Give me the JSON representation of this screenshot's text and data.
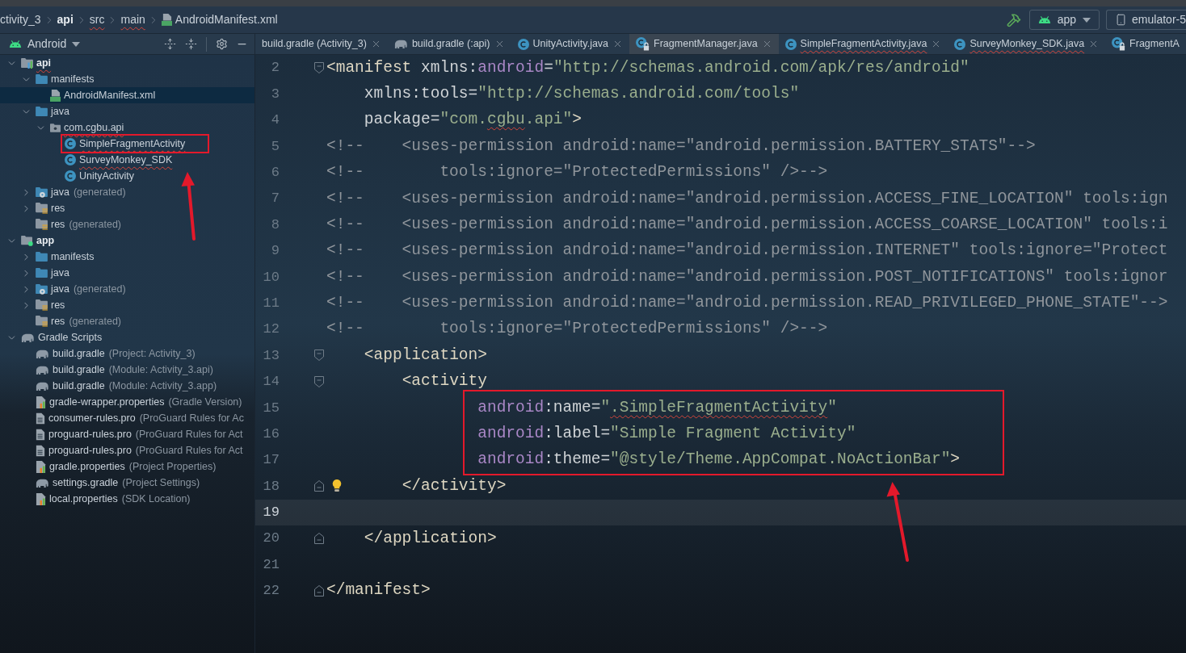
{
  "breadcrumbs": [
    {
      "label": "ctivity_3",
      "kind": "project",
      "typo": false
    },
    {
      "label": "api",
      "kind": "module",
      "typo": false
    },
    {
      "label": "src",
      "kind": "folder",
      "typo": true
    },
    {
      "label": "main",
      "kind": "folder",
      "typo": true
    },
    {
      "label": "AndroidManifest.xml",
      "kind": "manifest",
      "typo": false
    }
  ],
  "run_toolbar": {
    "configuration": "app",
    "device": "emulator-5"
  },
  "project_panel": {
    "view": "Android",
    "tree": [
      {
        "label": "api",
        "kind": "module",
        "expanded": true,
        "selected": false,
        "typo": true,
        "children": [
          {
            "label": "manifests",
            "kind": "folder",
            "expanded": true,
            "selected": false,
            "typo": false,
            "children": [
              {
                "label": "AndroidManifest.xml",
                "kind": "manifest",
                "selected": true,
                "typo": false
              }
            ]
          },
          {
            "label": "java",
            "kind": "folder",
            "expanded": true,
            "selected": false,
            "typo": false,
            "children": [
              {
                "label": "com.cgbu.api",
                "kind": "package",
                "expanded": true,
                "selected": false,
                "typo": true,
                "children": [
                  {
                    "label": "SimpleFragmentActivity",
                    "kind": "class",
                    "selected": false,
                    "typo": true,
                    "marked": true
                  },
                  {
                    "label": "SurveyMonkey_SDK",
                    "kind": "class",
                    "selected": false,
                    "typo": true
                  },
                  {
                    "label": "UnityActivity",
                    "kind": "class",
                    "selected": false,
                    "typo": false
                  }
                ]
              }
            ]
          },
          {
            "label": "java",
            "detail": "(generated)",
            "kind": "generated",
            "expanded": false,
            "selected": false,
            "typo": false
          },
          {
            "label": "res",
            "kind": "resources",
            "expanded": false,
            "selected": false,
            "typo": false
          },
          {
            "label": "res",
            "detail": "(generated)",
            "kind": "resources",
            "selected": false,
            "typo": false
          }
        ]
      },
      {
        "label": "app",
        "kind": "app",
        "expanded": true,
        "selected": false,
        "typo": false,
        "children": [
          {
            "label": "manifests",
            "kind": "folder",
            "expanded": false,
            "selected": false,
            "typo": false
          },
          {
            "label": "java",
            "kind": "folder",
            "expanded": false,
            "selected": false,
            "typo": false
          },
          {
            "label": "java",
            "detail": "(generated)",
            "kind": "generated",
            "expanded": false,
            "selected": false,
            "typo": false
          },
          {
            "label": "res",
            "kind": "resources",
            "expanded": false,
            "selected": false,
            "typo": false
          },
          {
            "label": "res",
            "detail": "(generated)",
            "kind": "resources",
            "selected": false,
            "typo": false
          }
        ]
      },
      {
        "label": "Gradle Scripts",
        "kind": "gradle",
        "expanded": true,
        "selected": false,
        "typo": false,
        "children": [
          {
            "label": "build.gradle",
            "detail": "(Project: Activity_3)",
            "kind": "gradle",
            "selected": false,
            "typo": false
          },
          {
            "label": "build.gradle",
            "detail": "(Module: Activity_3.api)",
            "kind": "gradle",
            "selected": false,
            "typo": false
          },
          {
            "label": "build.gradle",
            "detail": "(Module: Activity_3.app)",
            "kind": "gradle",
            "selected": false,
            "typo": false
          },
          {
            "label": "gradle-wrapper.properties",
            "detail": "(Gradle Version)",
            "kind": "properties",
            "selected": false,
            "typo": false
          },
          {
            "label": "consumer-rules.pro",
            "detail": "(ProGuard Rules for Ac",
            "kind": "text",
            "selected": false,
            "typo": false
          },
          {
            "label": "proguard-rules.pro",
            "detail": "(ProGuard Rules for Act",
            "kind": "text",
            "selected": false,
            "typo": false
          },
          {
            "label": "proguard-rules.pro",
            "detail": "(ProGuard Rules for Act",
            "kind": "text",
            "selected": false,
            "typo": false
          },
          {
            "label": "gradle.properties",
            "detail": "(Project Properties)",
            "kind": "properties",
            "selected": false,
            "typo": false
          },
          {
            "label": "settings.gradle",
            "detail": "(Project Settings)",
            "kind": "gradle",
            "selected": false,
            "typo": false
          },
          {
            "label": "local.properties",
            "detail": "(SDK Location)",
            "kind": "properties",
            "selected": false,
            "typo": false
          }
        ]
      }
    ]
  },
  "tabs": [
    {
      "label": "build.gradle (Activity_3)",
      "kind": "plain",
      "selected": false,
      "typo": false
    },
    {
      "label": "build.gradle (:api)",
      "kind": "gradle",
      "selected": false,
      "typo": false
    },
    {
      "label": "UnityActivity.java",
      "kind": "class",
      "selected": false,
      "typo": false,
      "read_only": false
    },
    {
      "label": "FragmentManager.java",
      "kind": "class",
      "selected": true,
      "typo": false,
      "read_only": true
    },
    {
      "label": "SimpleFragmentActivity.java",
      "kind": "class",
      "selected": false,
      "typo": true,
      "read_only": false
    },
    {
      "label": "SurveyMonkey_SDK.java",
      "kind": "class",
      "selected": false,
      "typo": true,
      "read_only": false
    },
    {
      "label": "FragmentA",
      "kind": "class",
      "selected": false,
      "typo": false,
      "read_only": true
    }
  ],
  "editor": {
    "lines": [
      {
        "number": "2",
        "kind": "open",
        "current": false,
        "tokens": [
          {
            "kind": "tag",
            "text": "<manifest"
          },
          {
            "kind": "attr",
            "text": " xmlns:"
          },
          {
            "kind": "ns",
            "text": "android"
          },
          {
            "kind": "punct",
            "text": "="
          },
          {
            "kind": "value",
            "text": "\"http://schemas.android.com/apk/res/android\""
          }
        ]
      },
      {
        "number": "3",
        "kind": "plain",
        "current": false,
        "tokens": [
          {
            "kind": "attr",
            "text": "    xmlns:tools"
          },
          {
            "kind": "punct",
            "text": "="
          },
          {
            "kind": "value",
            "text": "\"http://schemas.android.com/tools\""
          }
        ]
      },
      {
        "number": "4",
        "kind": "plain",
        "current": false,
        "tokens": [
          {
            "kind": "attr",
            "text": "    package"
          },
          {
            "kind": "punct",
            "text": "="
          },
          {
            "kind": "value",
            "text": "\"com."
          },
          {
            "kind": "value",
            "text": "cgbu",
            "typo": true
          },
          {
            "kind": "value",
            "text": ".api\""
          },
          {
            "kind": "tag",
            "text": ">"
          }
        ]
      },
      {
        "number": "5",
        "kind": "plain",
        "current": false,
        "tokens": [
          {
            "kind": "comment",
            "text": "<!--    <uses-permission android:name=\"android.permission.BATTERY_STATS\"-->"
          }
        ]
      },
      {
        "number": "6",
        "kind": "plain",
        "current": false,
        "tokens": [
          {
            "kind": "comment",
            "text": "<!--        tools:ignore=\"ProtectedPermissions\" />-->"
          }
        ]
      },
      {
        "number": "7",
        "kind": "plain",
        "current": false,
        "tokens": [
          {
            "kind": "comment",
            "text": "<!--    <uses-permission android:name=\"android.permission.ACCESS_FINE_LOCATION\" tools:ign"
          }
        ]
      },
      {
        "number": "8",
        "kind": "plain",
        "current": false,
        "tokens": [
          {
            "kind": "comment",
            "text": "<!--    <uses-permission android:name=\"android.permission.ACCESS_COARSE_LOCATION\" tools:i"
          }
        ]
      },
      {
        "number": "9",
        "kind": "plain",
        "current": false,
        "tokens": [
          {
            "kind": "comment",
            "text": "<!--    <uses-permission android:name=\"android.permission.INTERNET\" tools:ignore=\"Protect"
          }
        ]
      },
      {
        "number": "10",
        "kind": "plain",
        "current": false,
        "tokens": [
          {
            "kind": "comment",
            "text": "<!--    <uses-permission android:name=\"android.permission.POST_NOTIFICATIONS\" tools:ignor"
          }
        ]
      },
      {
        "number": "11",
        "kind": "plain",
        "current": false,
        "tokens": [
          {
            "kind": "comment",
            "text": "<!--    <uses-permission android:name=\"android.permission.READ_PRIVILEGED_PHONE_STATE\"-->"
          }
        ]
      },
      {
        "number": "12",
        "kind": "plain",
        "current": false,
        "tokens": [
          {
            "kind": "comment",
            "text": "<!--        tools:ignore=\"ProtectedPermissions\" />-->"
          }
        ]
      },
      {
        "number": "13",
        "kind": "open",
        "current": false,
        "tokens": [
          {
            "kind": "tag",
            "text": "    <application>"
          }
        ]
      },
      {
        "number": "14",
        "kind": "open",
        "current": false,
        "tokens": [
          {
            "kind": "tag",
            "text": "        <activity"
          }
        ]
      },
      {
        "number": "15",
        "kind": "plain",
        "current": false,
        "marked": true,
        "tokens": [
          {
            "kind": "ns",
            "text": "                android"
          },
          {
            "kind": "attr",
            "text": ":name"
          },
          {
            "kind": "punct",
            "text": "="
          },
          {
            "kind": "value",
            "text": "\""
          },
          {
            "kind": "value",
            "text": ".SimpleFragmentActivity",
            "typo": true
          },
          {
            "kind": "value",
            "text": "\""
          }
        ]
      },
      {
        "number": "16",
        "kind": "plain",
        "current": false,
        "marked": true,
        "tokens": [
          {
            "kind": "ns",
            "text": "                android"
          },
          {
            "kind": "attr",
            "text": ":label"
          },
          {
            "kind": "punct",
            "text": "="
          },
          {
            "kind": "value",
            "text": "\"Simple Fragment Activity\""
          }
        ]
      },
      {
        "number": "17",
        "kind": "plain",
        "current": false,
        "marked": true,
        "tokens": [
          {
            "kind": "ns",
            "text": "                android"
          },
          {
            "kind": "attr",
            "text": ":theme"
          },
          {
            "kind": "punct",
            "text": "="
          },
          {
            "kind": "value",
            "text": "\"@style/Theme.AppCompat.NoActionBar\""
          },
          {
            "kind": "tag",
            "text": ">"
          }
        ]
      },
      {
        "number": "18",
        "kind": "close",
        "bulb": true,
        "current": false,
        "tokens": [
          {
            "kind": "tag",
            "text": "        </activity>"
          }
        ]
      },
      {
        "number": "19",
        "kind": "plain",
        "current": true
      },
      {
        "number": "20",
        "kind": "close",
        "current": false,
        "tokens": [
          {
            "kind": "tag",
            "text": "    </application>"
          }
        ]
      },
      {
        "number": "21",
        "kind": "plain",
        "current": false
      },
      {
        "number": "22",
        "kind": "close",
        "current": false,
        "tokens": [
          {
            "kind": "tag",
            "text": "</manifest>"
          }
        ]
      }
    ]
  }
}
